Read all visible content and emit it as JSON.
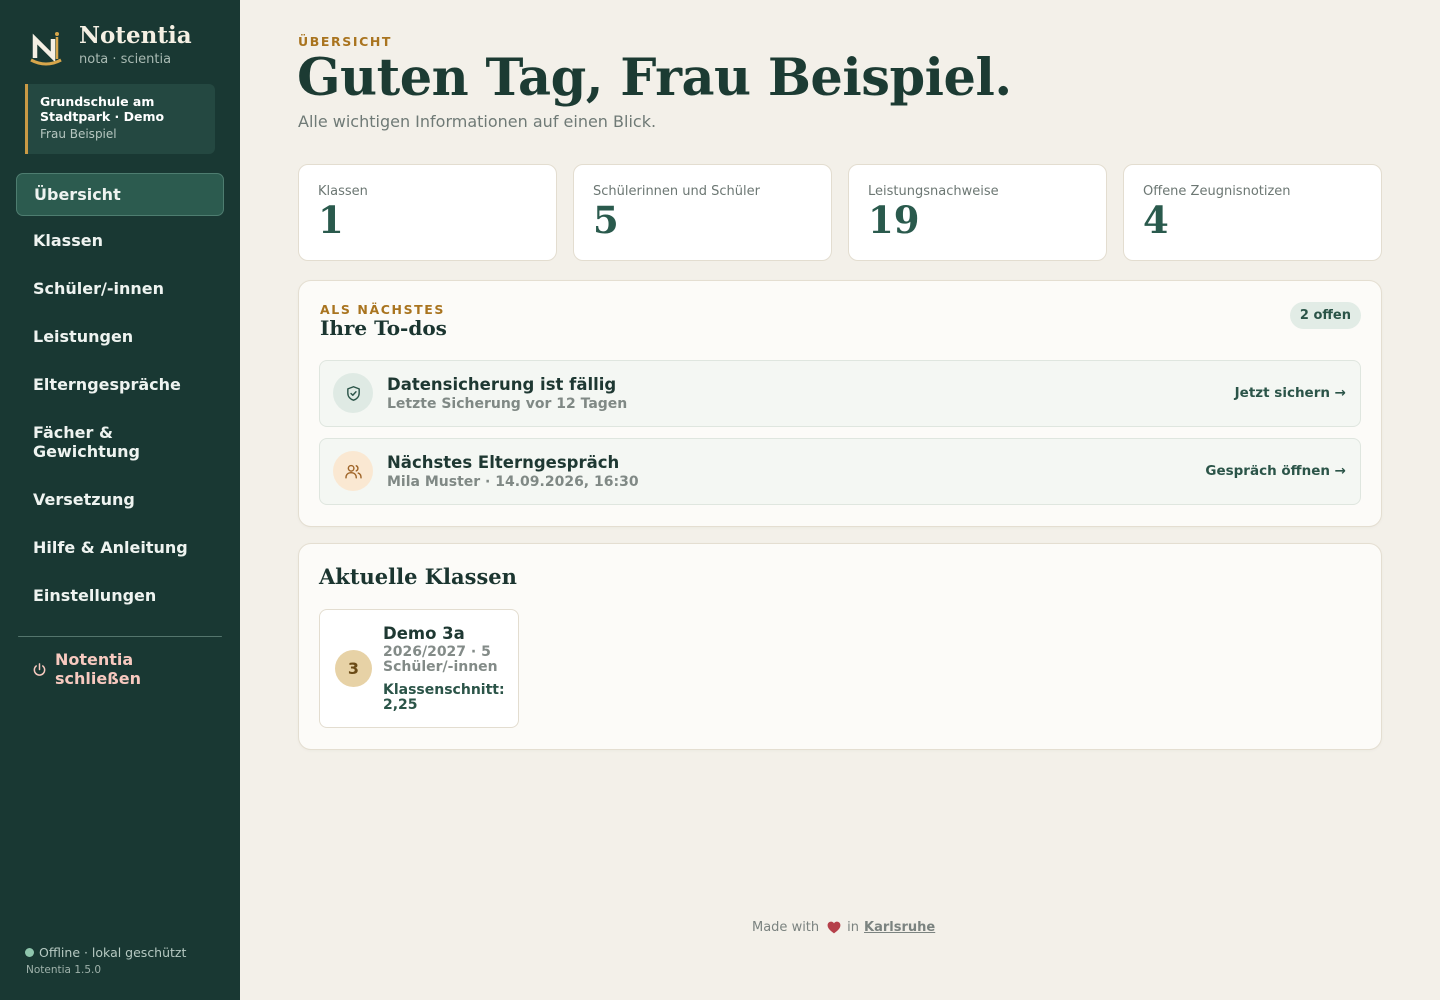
{
  "brand": {
    "name": "Notentia",
    "tagline": "nota · scientia"
  },
  "school": {
    "name": "Grundschule am Stadtpark · Demo",
    "user": "Frau Beispiel"
  },
  "nav": {
    "items": [
      {
        "label": "Übersicht",
        "active": true
      },
      {
        "label": "Klassen"
      },
      {
        "label": "Schüler/-innen"
      },
      {
        "label": "Leistungen"
      },
      {
        "label": "Elterngespräche"
      },
      {
        "label": "Fächer & Gewichtung"
      },
      {
        "label": "Versetzung"
      },
      {
        "label": "Hilfe & Anleitung"
      },
      {
        "label": "Einstellungen"
      }
    ],
    "quit_label": "Notentia schließen"
  },
  "status": {
    "text": "Offline · lokal geschützt",
    "version": "Notentia 1.5.0"
  },
  "page": {
    "eyebrow": "ÜBERSICHT",
    "title": "Guten Tag, Frau Beispiel.",
    "subtitle": "Alle wichtigen Informationen auf einen Blick."
  },
  "stats": [
    {
      "label": "Klassen",
      "value": "1"
    },
    {
      "label": "Schülerinnen und Schüler",
      "value": "5"
    },
    {
      "label": "Leistungsnachweise",
      "value": "19"
    },
    {
      "label": "Offene Zeugnisnotizen",
      "value": "4"
    }
  ],
  "todos": {
    "eyebrow": "ALS NÄCHSTES",
    "title": "Ihre To-dos",
    "badge": "2 offen",
    "items": [
      {
        "icon": "shield-check-icon",
        "title": "Datensicherung ist fällig",
        "subtitle": "Letzte Sicherung vor 12 Tagen",
        "action": "Jetzt sichern →"
      },
      {
        "icon": "users-icon",
        "title": "Nächstes Elterngespräch",
        "subtitle": "Mila Muster · 14.09.2026, 16:30",
        "action": "Gespräch öffnen →"
      }
    ]
  },
  "classes": {
    "title": "Aktuelle Klassen",
    "items": [
      {
        "grade": "3",
        "name": "Demo 3a",
        "meta": "2026/2027 · 5 Schüler/-innen",
        "average": "Klassenschnitt: 2,25"
      }
    ]
  },
  "footer": {
    "made_with": "Made with",
    "in": "in",
    "city": "Karlsruhe"
  },
  "colors": {
    "sidebar": "#193833",
    "accent": "#c99a45",
    "primary": "#2a5a4d",
    "background": "#f3f0e9",
    "heart": "#b5404a"
  }
}
